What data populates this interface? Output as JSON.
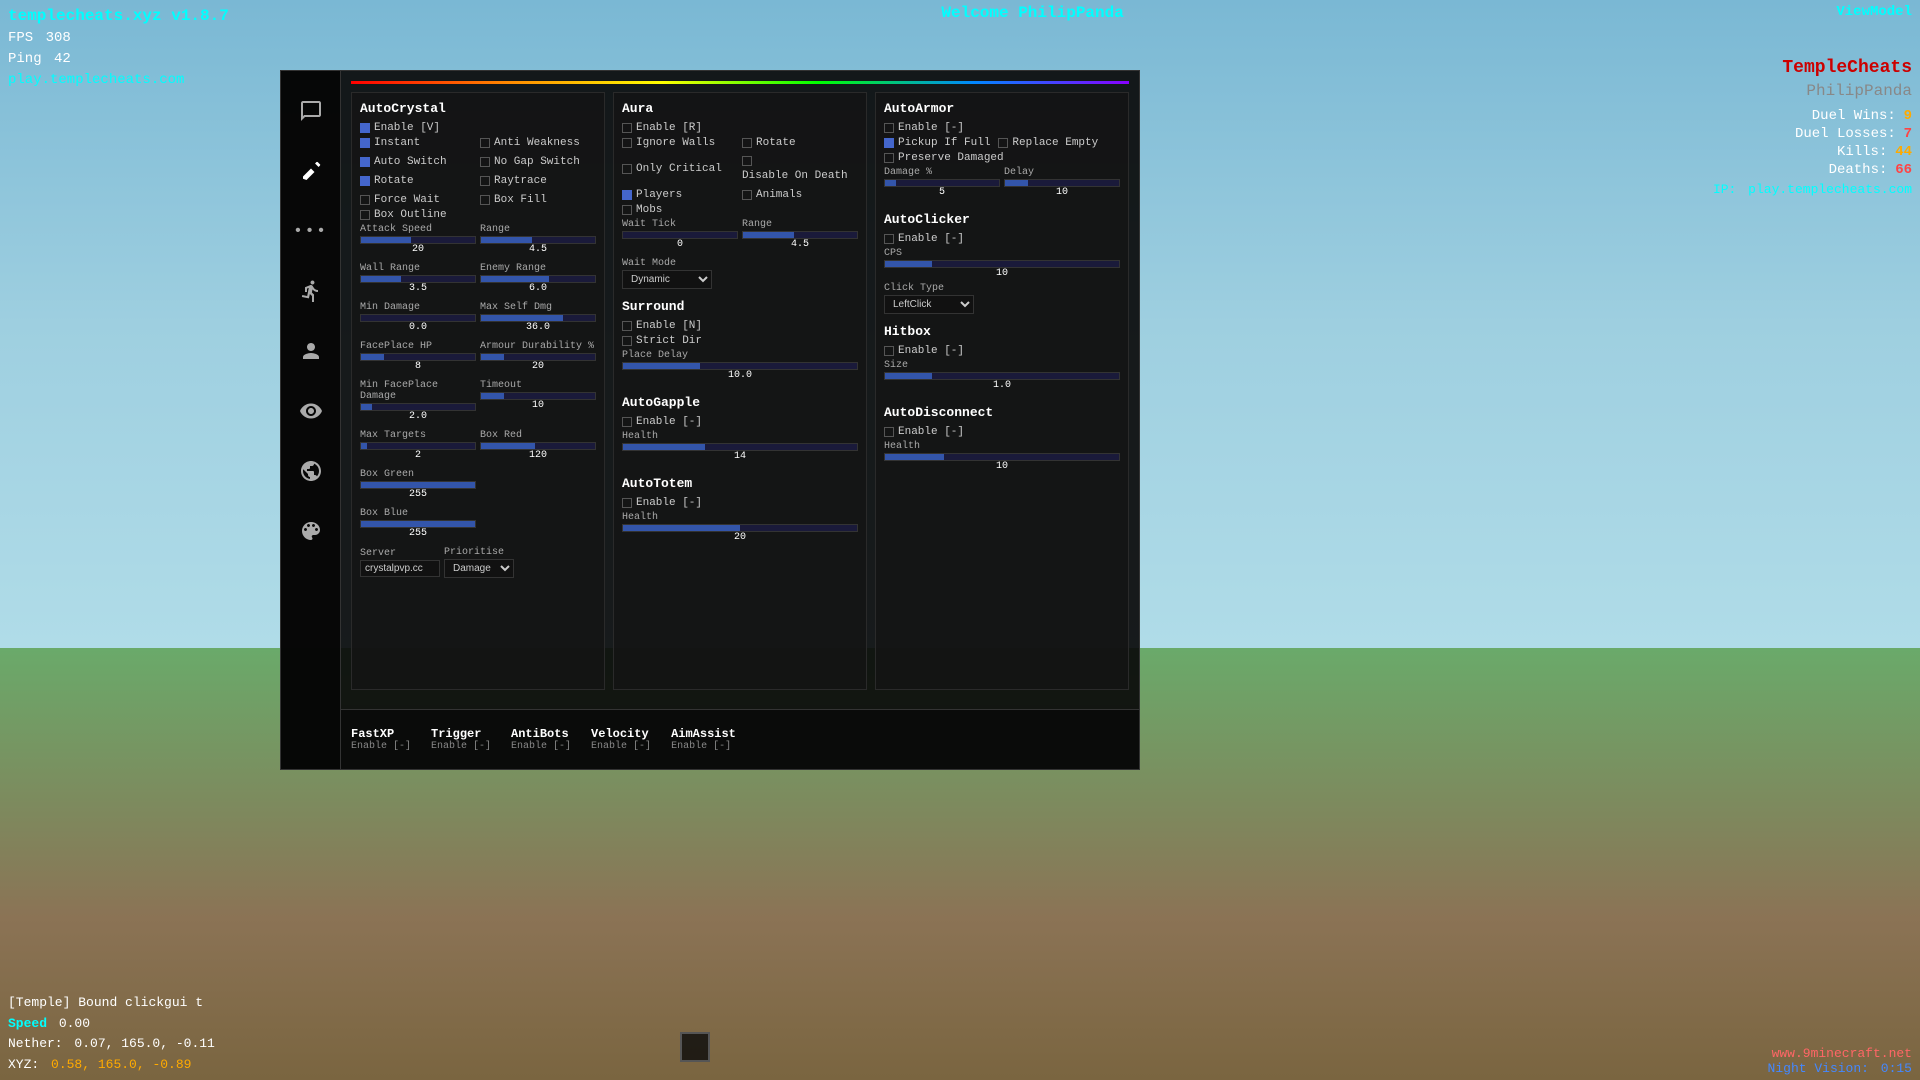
{
  "hud": {
    "title": "templecheats.xyz v1.8.7",
    "fps_label": "FPS",
    "fps_val": "308",
    "ping_label": "Ping",
    "ping_val": "42",
    "server": "play.templecheats.com",
    "welcome": "Welcome PhilipPanda",
    "viewmodel": "ViewModel"
  },
  "right_panel": {
    "logo": "TempleCheats",
    "username": "PhilipPanda",
    "duel_wins_label": "Duel Wins:",
    "duel_wins_val": "9",
    "duel_losses_label": "Duel Losses:",
    "duel_losses_val": "7",
    "kills_label": "Kills:",
    "kills_val": "44",
    "deaths_label": "Deaths:",
    "deaths_val": "66",
    "ip_label": "IP:",
    "ip_val": "play.templecheats.com"
  },
  "bottom_hud": {
    "chat_tag": "[Temple]",
    "chat_msg": "Bound clickgui t",
    "speed_label": "Speed",
    "speed_val": "0.00",
    "nether_label": "Nether:",
    "nether_val": "0.07, 165.0, -0.11",
    "xyz_label": "XYZ:",
    "xyz_val": "0.58, 165.0, -0.89",
    "website": "www.9minecraft.net",
    "night_label": "Night Vision:",
    "night_val": "0:15"
  },
  "gui": {
    "auto_crystal": {
      "title": "AutoCrystal",
      "enable_label": "Enable [V]",
      "enable_checked": true,
      "instant_label": "Instant",
      "instant_checked": true,
      "anti_weakness_label": "Anti Weakness",
      "anti_weakness_checked": false,
      "auto_switch_label": "Auto Switch",
      "auto_switch_checked": true,
      "no_gap_switch_label": "No Gap Switch",
      "no_gap_switch_checked": false,
      "rotate_label": "Rotate",
      "rotate_checked": true,
      "raytrace_label": "Raytrace",
      "raytrace_checked": false,
      "force_wait_label": "Force Wait",
      "force_wait_checked": false,
      "box_fill_label": "Box Fill",
      "box_fill_checked": false,
      "box_outline_label": "Box Outline",
      "box_outline_checked": false,
      "attack_speed_label": "Attack Speed",
      "attack_speed_val": "20",
      "attack_speed_pct": 44,
      "range_label": "Range",
      "range_val": "4.5",
      "range_pct": 45,
      "wall_range_label": "Wall Range",
      "wall_range_val": "3.5",
      "wall_range_pct": 35,
      "enemy_range_label": "Enemy Range",
      "enemy_range_val": "6.0",
      "enemy_range_pct": 60,
      "min_damage_label": "Min Damage",
      "min_damage_val": "0.0",
      "min_damage_pct": 0,
      "max_self_dmg_label": "Max Self Dmg",
      "max_self_dmg_val": "36.0",
      "max_self_dmg_pct": 72,
      "faceplace_hp_label": "FacePlace HP",
      "faceplace_hp_val": "8",
      "faceplace_hp_pct": 20,
      "armour_dur_label": "Armour Durability %",
      "armour_dur_val": "20",
      "armour_dur_pct": 20,
      "min_faceplace_dmg_label": "Min FacePlace Damage",
      "min_faceplace_dmg_val": "2.0",
      "min_faceplace_dmg_pct": 10,
      "timeout_label": "Timeout",
      "timeout_val": "10",
      "timeout_pct": 20,
      "max_targets_label": "Max Targets",
      "max_targets_val": "2",
      "max_targets_pct": 5,
      "box_red_label": "Box Red",
      "box_red_val": "120",
      "box_red_pct": 47,
      "box_green_label": "Box Green",
      "box_green_val": "255",
      "box_green_pct": 100,
      "box_blue_label": "Box Blue",
      "box_blue_val": "255",
      "box_blue_pct": 100,
      "server_label": "Server",
      "server_val": "crystalpvp.cc",
      "prioritise_label": "Prioritise",
      "prioritise_val": "Damage"
    },
    "aura": {
      "title": "Aura",
      "enable_label": "Enable [R]",
      "enable_checked": false,
      "ignore_walls_label": "Ignore Walls",
      "ignore_walls_checked": false,
      "rotate_label": "Rotate",
      "rotate_checked": false,
      "only_critical_label": "Only Critical",
      "only_critical_checked": false,
      "disable_on_death_label": "Disable On Death",
      "disable_on_death_checked": false,
      "players_label": "Players",
      "players_checked": true,
      "animals_label": "Animals",
      "animals_checked": false,
      "mobs_label": "Mobs",
      "mobs_checked": false,
      "wait_tick_label": "Wait Tick",
      "wait_tick_val": "0",
      "wait_tick_pct": 0,
      "range_label": "Range",
      "range_val": "4.5",
      "range_pct": 45,
      "wait_mode_label": "Wait Mode",
      "wait_mode_val": "Dynamic"
    },
    "surround": {
      "title": "Surround",
      "enable_label": "Enable [N]",
      "enable_checked": false,
      "strict_dir_label": "Strict Dir",
      "strict_dir_checked": false,
      "place_delay_label": "Place Delay",
      "place_delay_val": "10.0",
      "place_delay_pct": 33
    },
    "auto_gapple": {
      "title": "AutoGapple",
      "enable_label": "Enable [-]",
      "enable_checked": false,
      "health_label": "Health",
      "health_val": "14",
      "health_pct": 35
    },
    "auto_totem": {
      "title": "AutoTotem",
      "enable_label": "Enable [-]",
      "enable_checked": false,
      "health_label": "Health",
      "health_val": "20",
      "health_pct": 50
    },
    "auto_armor": {
      "title": "AutoArmor",
      "enable_label": "Enable [-]",
      "enable_checked": false,
      "pickup_full_label": "Pickup If Full",
      "pickup_full_checked": true,
      "replace_empty_label": "Replace Empty",
      "replace_empty_checked": false,
      "preserve_damaged_label": "Preserve Damaged",
      "preserve_damaged_checked": false,
      "damage_pct_label": "Damage %",
      "damage_pct_val": "5",
      "damage_pct_pct": 10,
      "delay_label": "Delay",
      "delay_val": "10",
      "delay_pct": 20
    },
    "auto_clicker": {
      "title": "AutoClicker",
      "enable_label": "Enable [-]",
      "enable_checked": false,
      "cps_label": "CPS",
      "cps_val": "10",
      "cps_pct": 20,
      "click_type_label": "Click Type",
      "click_type_val": "LeftClick"
    },
    "hitbox": {
      "title": "Hitbox",
      "enable_label": "Enable [-]",
      "enable_checked": false,
      "size_label": "Size",
      "size_val": "1.0",
      "size_pct": 20
    },
    "auto_disconnect": {
      "title": "AutoDisconnect",
      "enable_label": "Enable [-]",
      "enable_checked": false,
      "health_label": "Health",
      "health_val": "10",
      "health_pct": 25
    }
  },
  "bottom_tabs": [
    {
      "name": "FastXP",
      "enable": "Enable [-]",
      "enabled": false
    },
    {
      "name": "Trigger",
      "enable": "Enable [-]",
      "enabled": false
    },
    {
      "name": "AntiBots",
      "enable": "Enable [-]",
      "enabled": false
    },
    {
      "name": "Velocity",
      "enable": "Enable [-]",
      "enabled": false
    },
    {
      "name": "AimAssist",
      "enable": "Enable [-]",
      "enabled": false
    }
  ]
}
